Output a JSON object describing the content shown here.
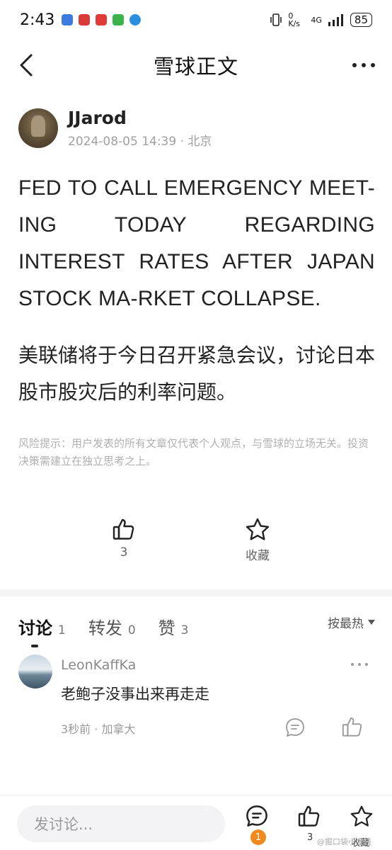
{
  "status_bar": {
    "time": "2:43",
    "network_speed": "0 K/s",
    "network_type": "4G",
    "battery": "85"
  },
  "header": {
    "title": "雪球正文"
  },
  "author": {
    "name": "JJarod",
    "meta": "2024-08-05 14:39 · 北京"
  },
  "post": {
    "text_en": "FED TO CALL EMERGENCY MEET-ING TODAY REGARDING INTEREST RATES AFTER JAPAN STOCK MA-RKET COLLAPSE.",
    "text_cn": "美联储将于今日召开紧急会议，讨论日本股市股灾后的利率问题。",
    "risk_notice": "风险提示：用户发表的所有文章仅代表个人观点，与雪球的立场无关。投资决策需建立在独立思考之上。"
  },
  "actions": {
    "like_count": "3",
    "favorite_label": "收藏"
  },
  "tabs": [
    {
      "label": "讨论",
      "count": "1"
    },
    {
      "label": "转发",
      "count": "0"
    },
    {
      "label": "赞",
      "count": "3"
    }
  ],
  "sort_label": "按最热",
  "comment": {
    "user": "LeonKaffKa",
    "text": "老鲍子没事出来再走走",
    "meta": "3秒前 · 加拿大"
  },
  "bottom_bar": {
    "input_placeholder": "发讨论...",
    "comment_badge": "1",
    "like_count": "3",
    "favorite_label": "收藏"
  },
  "watermark": "@掘口袋小金钱"
}
